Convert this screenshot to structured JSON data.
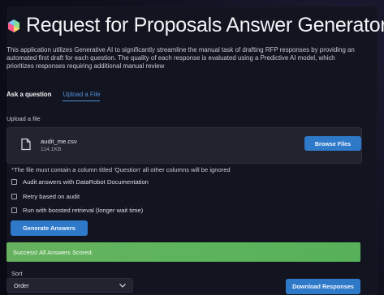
{
  "app": {
    "title": "Request for Proposals Answer Generator",
    "description": "This application utilizes Generative AI to significantly streamline the manual task of drafting RFP responses by providing an automated first draft for each question. The quality of each response is evaluated using a Predictive AI model, which prioritizes responses requiring additional manual review"
  },
  "tabs": [
    {
      "label": "Ask a question"
    },
    {
      "label": "Upload a File"
    }
  ],
  "upload": {
    "label": "Upload a file",
    "file_name": "audit_me.csv",
    "file_size": "114.1KB",
    "browse_label": "Browse Files"
  },
  "note": "*The file must contain a column titled 'Question' all other columns will be ignored",
  "options": [
    {
      "label": "Audit answers with DataRobot Documentation"
    },
    {
      "label": "Retry based on audit"
    },
    {
      "label": "Run with boosted retrieval (longer wait time)"
    }
  ],
  "actions": {
    "generate_label": "Generate Answers",
    "download_label": "Download Responses"
  },
  "status": {
    "message": "Success! All Answers Scored."
  },
  "sort": {
    "label": "Sort",
    "selected": "Order"
  },
  "colors": {
    "accent": "#2f79c9",
    "success": "#5eb45d",
    "link": "#4f93d9"
  },
  "icons": {
    "app_logo": "cube-logo-icon",
    "file": "document-icon",
    "select": "chevron-down-icon"
  }
}
